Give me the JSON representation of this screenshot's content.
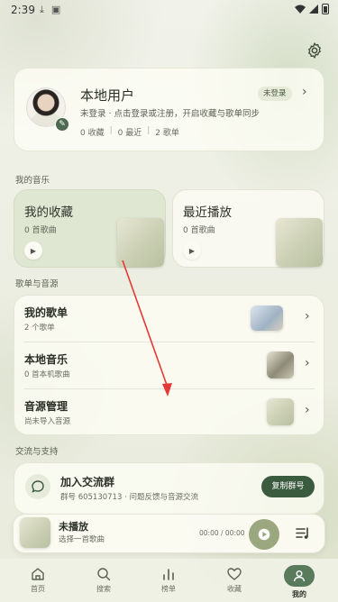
{
  "status_bar": {
    "time": "2:39",
    "icons": [
      "download-icon",
      "image-icon"
    ],
    "battery_icon": "battery-icon",
    "wifi_icon": "wifi-icon",
    "signal_icon": "signal-icon"
  },
  "profile": {
    "name": "本地用户",
    "description": "未登录 · 点击登录或注册，开启收藏与歌单同步",
    "login_status": "未登录",
    "stats": [
      "0 收藏",
      "0 最近",
      "2 歌单"
    ],
    "stat_separator": "|"
  },
  "sections": {
    "my_music": "我的音乐",
    "playlists_sources": "歌单与音源",
    "community": "交流与支持"
  },
  "tiles": {
    "favorites": {
      "title": "我的收藏",
      "subtitle": "0 首歌曲"
    },
    "recent": {
      "title": "最近播放",
      "subtitle": "0 首歌曲"
    }
  },
  "list": [
    {
      "title": "我的歌单",
      "subtitle": "2 个歌单"
    },
    {
      "title": "本地音乐",
      "subtitle": "0 首本机歌曲"
    },
    {
      "title": "音源管理",
      "subtitle": "尚未导入音源"
    }
  ],
  "community": {
    "title": "加入交流群",
    "subtitle": "群号 605130713 · 问题反馈与音源交流",
    "button": "复制群号"
  },
  "player": {
    "title": "未播放",
    "subtitle": "选择一首歌曲",
    "time": "00:00 / 00:00"
  },
  "bottom_nav": [
    {
      "label": "首页",
      "icon": "home-icon"
    },
    {
      "label": "搜索",
      "icon": "search-icon"
    },
    {
      "label": "榜单",
      "icon": "chart-icon"
    },
    {
      "label": "收藏",
      "icon": "heart-icon"
    },
    {
      "label": "我的",
      "icon": "user-icon",
      "active": true
    }
  ],
  "colors": {
    "accent": "#3b5b3f",
    "play_button": "#9aa77f",
    "annotation_arrow": "#e53935"
  }
}
